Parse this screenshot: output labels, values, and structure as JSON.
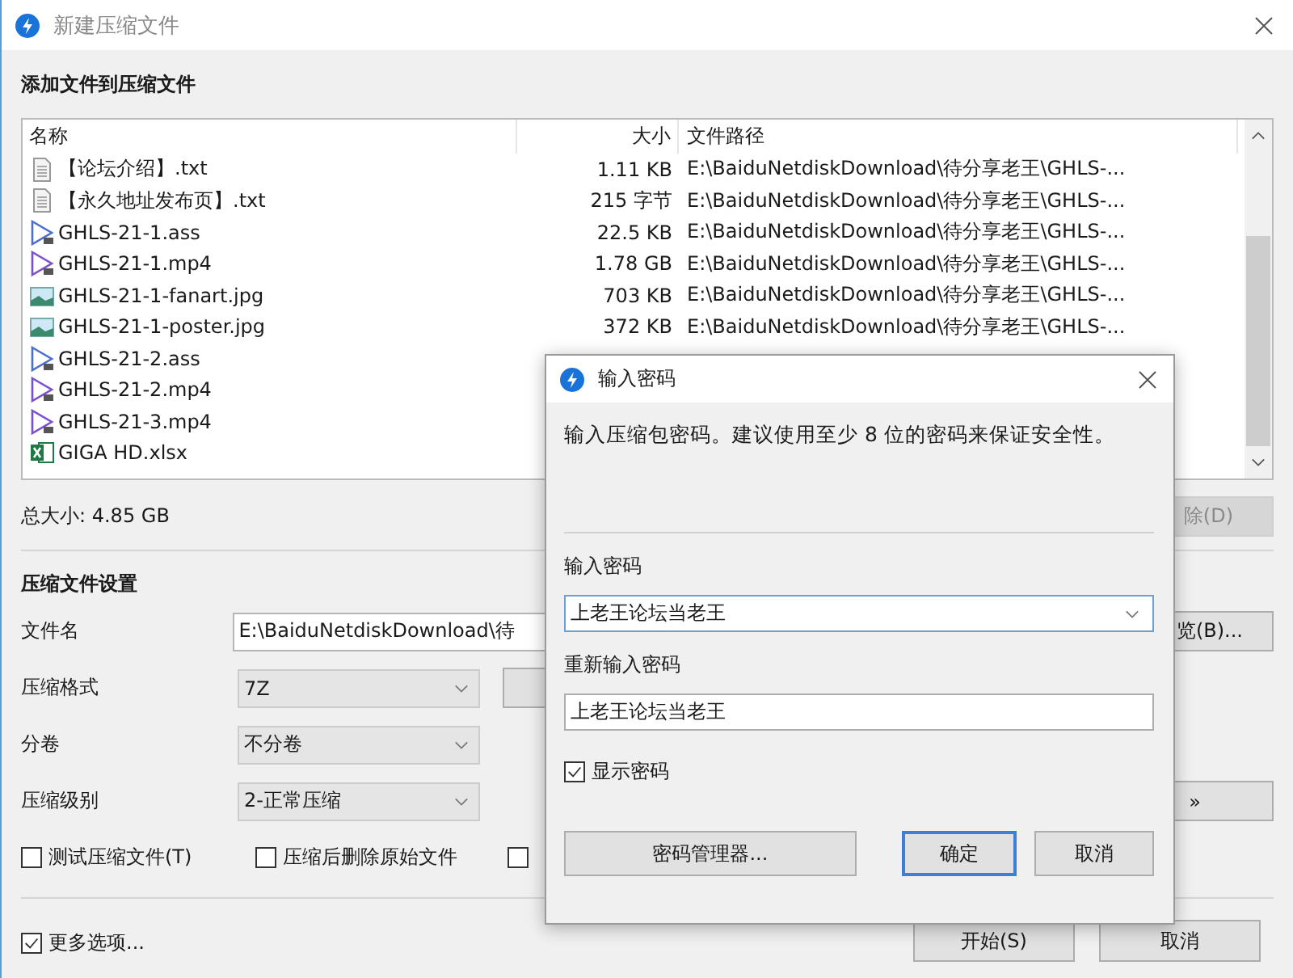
{
  "window": {
    "title": "新建压缩文件"
  },
  "files_section": {
    "heading": "添加文件到压缩文件",
    "columns": [
      "名称",
      "大小",
      "文件路径"
    ],
    "rows": [
      {
        "kind": "text",
        "name": "【论坛介绍】.txt",
        "size": "1.11 KB",
        "path": "E:\\BaiduNetdiskDownload\\待分享老王\\GHLS-..."
      },
      {
        "kind": "text",
        "name": "【永久地址发布页】.txt",
        "size": "215 字节",
        "path": "E:\\BaiduNetdiskDownload\\待分享老王\\GHLS-..."
      },
      {
        "kind": "subtitle",
        "name": "GHLS-21-1.ass",
        "size": "22.5 KB",
        "path": "E:\\BaiduNetdiskDownload\\待分享老王\\GHLS-..."
      },
      {
        "kind": "video",
        "name": "GHLS-21-1.mp4",
        "size": "1.78 GB",
        "path": "E:\\BaiduNetdiskDownload\\待分享老王\\GHLS-..."
      },
      {
        "kind": "image",
        "name": "GHLS-21-1-fanart.jpg",
        "size": "703 KB",
        "path": "E:\\BaiduNetdiskDownload\\待分享老王\\GHLS-..."
      },
      {
        "kind": "image",
        "name": "GHLS-21-1-poster.jpg",
        "size": "372 KB",
        "path": "E:\\BaiduNetdiskDownload\\待分享老王\\GHLS-..."
      },
      {
        "kind": "subtitle",
        "name": "GHLS-21-2.ass"
      },
      {
        "kind": "video",
        "name": "GHLS-21-2.mp4"
      },
      {
        "kind": "video",
        "name": "GHLS-21-3.mp4"
      },
      {
        "kind": "excel",
        "name": "GIGA HD.xlsx"
      }
    ],
    "total": "总大小: 4.85 GB",
    "delete_button": {
      "label": "除(D)",
      "disabled": true
    }
  },
  "settings": {
    "heading": "压缩文件设置",
    "filename_label": "文件名",
    "filename_value": "E:\\BaiduNetdiskDownload\\待",
    "browse_button": "览(B)...",
    "format_label": "压缩格式",
    "format_value": "7Z",
    "split_label": "分卷",
    "split_value": "不分卷",
    "level_label": "压缩级别",
    "level_value": "2-正常压缩",
    "more_button": "»",
    "checkboxes": [
      {
        "label": "测试压缩文件(T)",
        "checked": false
      },
      {
        "label": "压缩后删除原始文件",
        "checked": false
      },
      {
        "checked": false
      }
    ]
  },
  "more_options": {
    "label": "更多选项...",
    "checked": true
  },
  "buttons": [
    "开始(S)",
    "取消"
  ],
  "dialog": {
    "title": "输入密码",
    "message": "输入压缩包密码。建议使用至少 8 位的密码来保证安全性。",
    "password_label": "输入密码",
    "password_value": "上老王论坛当老王",
    "confirm_label": "重新输入密码",
    "confirm_value": "上老王论坛当老王",
    "show_password": {
      "label": "显示密码",
      "checked": true
    },
    "buttons": [
      {
        "label": "密码管理器...",
        "default": false
      },
      {
        "label": "确定",
        "default": true
      },
      {
        "label": "取消",
        "default": false
      }
    ]
  }
}
